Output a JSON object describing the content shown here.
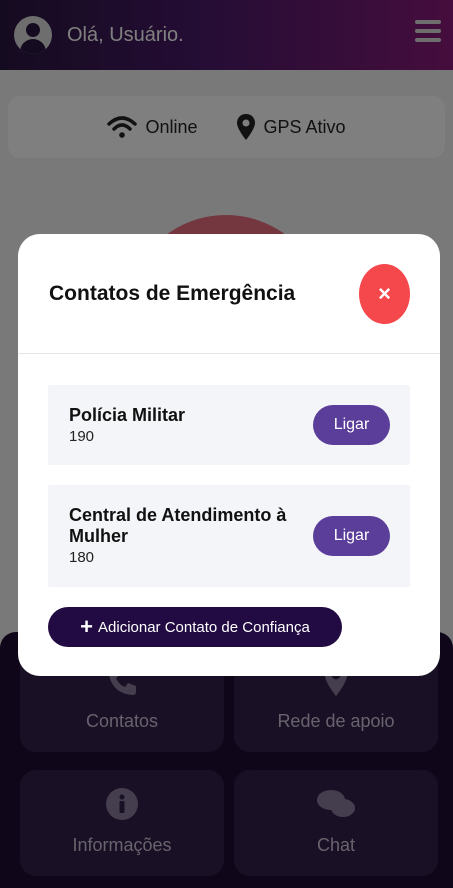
{
  "header": {
    "greeting": "Olá, Usuário.",
    "avatar_icon": "user-circle-icon",
    "menu_icon": "hamburger-menu-icon"
  },
  "status": {
    "network_label": "Online",
    "gps_label": "GPS Ativo"
  },
  "tiles": [
    {
      "label": "Contatos",
      "icon": "phone-icon"
    },
    {
      "label": "Rede de apoio",
      "icon": "map-pin-icon"
    },
    {
      "label": "Informações",
      "icon": "info-icon"
    },
    {
      "label": "Chat",
      "icon": "chat-bubbles-icon"
    }
  ],
  "modal": {
    "title": "Contatos de Emergência",
    "close_label": "×",
    "contacts": [
      {
        "name": "Polícia Militar",
        "phone": "190",
        "call_label": "Ligar"
      },
      {
        "name": "Central de Atendimento à Mulher",
        "phone": "180",
        "call_label": "Ligar"
      }
    ],
    "add_label": "Adicionar Contato de Confiança",
    "add_icon": "+"
  },
  "colors": {
    "accent": "#5b3d9a",
    "danger": "#f5484c",
    "dark": "#220b43"
  }
}
